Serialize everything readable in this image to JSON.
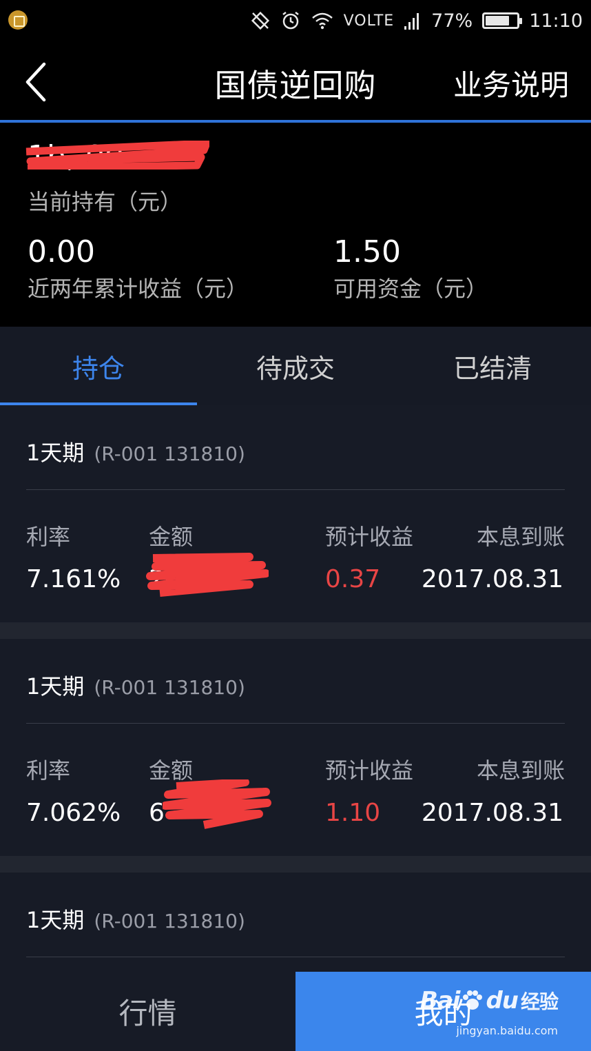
{
  "status_bar": {
    "network": "VOLTE",
    "battery": "77%",
    "battery_level": 0.77,
    "time": "11:10"
  },
  "header": {
    "title": "国债逆回购",
    "help": "业务说明"
  },
  "summary": {
    "holding_value": "1b,.00",
    "holding_label": "当前持有（元）",
    "earnings_value": "0.00",
    "earnings_label": "近两年累计收益（元）",
    "funds_value": "1.50",
    "funds_label": "可用资金（元）"
  },
  "tabs": [
    {
      "label": "持仓",
      "active": true
    },
    {
      "label": "待成交",
      "active": false
    },
    {
      "label": "已结清",
      "active": false
    }
  ],
  "columns": {
    "rate": "利率",
    "amount": "金额",
    "expected": "预计收益",
    "payout": "本息到账"
  },
  "positions": [
    {
      "term": "1天期",
      "code": "(R-001 131810)",
      "rate": "7.161%",
      "amount": "20",
      "expected": "0.37",
      "payout": "2017.08.31"
    },
    {
      "term": "1天期",
      "code": "(R-001 131810)",
      "rate": "7.062%",
      "amount": "6",
      "expected": "1.10",
      "payout": "2017.08.31"
    },
    {
      "term": "1天期",
      "code": "(R-001 131810)"
    }
  ],
  "bottom_nav": {
    "market": "行情",
    "mine": "我的"
  },
  "watermark": {
    "brand_left": "Bai",
    "brand_right": "du",
    "brand_cn": "经验",
    "url": "jingyan.baidu.com"
  },
  "colors": {
    "accent": "#3d85ec",
    "loss_red": "#e84545",
    "card_bg": "#171b26",
    "header_line": "#2f73d9"
  }
}
